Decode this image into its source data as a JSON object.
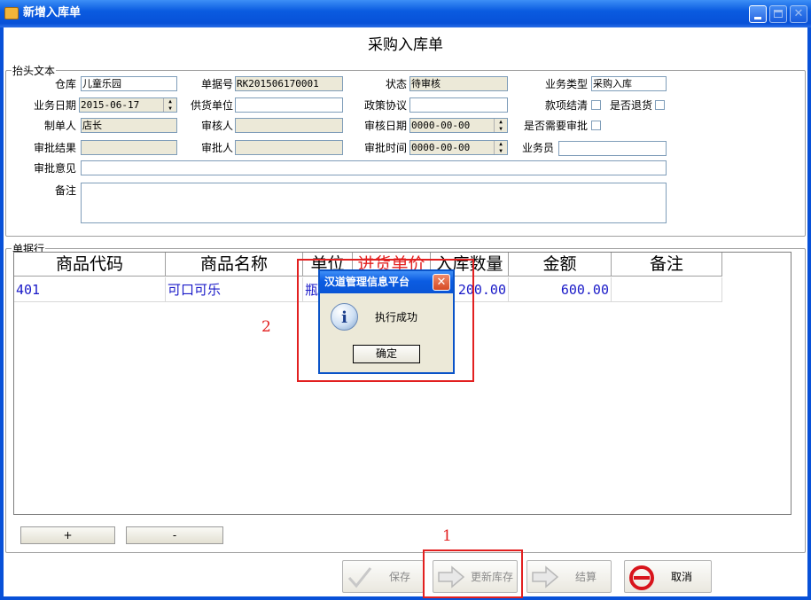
{
  "window": {
    "title": "新增入库单"
  },
  "form_title": "采购入库单",
  "header_group": {
    "legend": "抬头文本",
    "warehouse": {
      "label": "仓库",
      "value": "儿童乐园"
    },
    "doc_no": {
      "label": "单据号",
      "value": "RK201506170001"
    },
    "status": {
      "label": "状态",
      "value": "待审核"
    },
    "biz_type": {
      "label": "业务类型",
      "value": "采购入库"
    },
    "biz_date": {
      "label": "业务日期",
      "value": "2015-06-17"
    },
    "supplier": {
      "label": "供货单位",
      "value": ""
    },
    "policy": {
      "label": "政策协议",
      "value": ""
    },
    "settled": {
      "label": "款项结清"
    },
    "returned": {
      "label": "是否退货"
    },
    "creator": {
      "label": "制单人",
      "value": "店长"
    },
    "reviewer": {
      "label": "审核人",
      "value": ""
    },
    "review_date": {
      "label": "审核日期",
      "value": "0000-00-00"
    },
    "need_approval": {
      "label": "是否需要审批"
    },
    "approval_result": {
      "label": "审批结果",
      "value": ""
    },
    "approver": {
      "label": "审批人",
      "value": ""
    },
    "approval_time": {
      "label": "审批时间",
      "value": "0000-00-00"
    },
    "salesman": {
      "label": "业务员",
      "value": ""
    },
    "approval_opinion": {
      "label": "审批意见",
      "value": ""
    },
    "remark": {
      "label": "备注",
      "value": ""
    }
  },
  "lines_group": {
    "legend": "单据行",
    "columns": [
      "商品代码",
      "商品名称",
      "单位",
      "进货单价",
      "入库数量",
      "金额",
      "备注"
    ],
    "rows": [
      [
        "401",
        "可口可乐",
        "瓶",
        "",
        "200.00",
        "600.00",
        ""
      ]
    ],
    "add_label": "+",
    "remove_label": "-"
  },
  "toolbar": {
    "save_label": "保存",
    "update_stock_label": "更新库存",
    "settle_label": "结算",
    "cancel_label": "取消"
  },
  "annotations": {
    "marker_1": "1",
    "marker_2": "2"
  },
  "dialog": {
    "title": "汉道管理信息平台",
    "message": "执行成功",
    "ok_label": "确定"
  },
  "colors": {
    "titlebar": "#0851d8",
    "grid_text": "#1a1ac8",
    "highlight_column_header": "#e22020",
    "annotation_red": "#e22020",
    "readonly_field": "#ece9d8"
  }
}
